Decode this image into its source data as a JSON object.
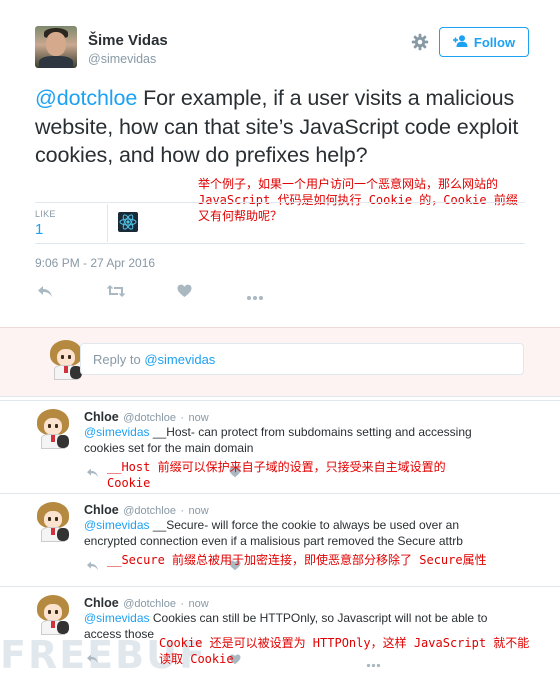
{
  "author": {
    "name": "Šime Vidas",
    "handle": "@simevidas"
  },
  "follow_label": "Follow",
  "tweet": {
    "mention": "@dotchloe",
    "text": " For example, if a user visits a malicious website, how can that site’s JavaScript code exploit cookies, and how do prefixes help?",
    "translation": "举个例子，如果一个用户访问一个恶意网站，那么网站的 JavaScript 代码是如何执行 Cookie 的，Cookie 前缀又有何帮助呢？",
    "like_label": "LIKE",
    "like_count": "1",
    "timestamp": "9:06 PM - 27 Apr 2016"
  },
  "reply_box": {
    "prefix": "Reply to ",
    "mention": "@simevidas"
  },
  "replies": [
    {
      "name": "Chloe",
      "handle": "@dotchloe",
      "dot": "·",
      "time": "now",
      "mention": "@simevidas",
      "text": " __Host- can protect from subdomains setting and accessing cookies set for the main domain",
      "translation": "__Host 前缀可以保护来自子域的设置，只接受来自主域设置的 Cookie"
    },
    {
      "name": "Chloe",
      "handle": "@dotchloe",
      "dot": "·",
      "time": "now",
      "mention": "@simevidas",
      "text": " __Secure- will force the cookie to always be used over an encrypted connection even if a malisious part removed the Secure attrb",
      "translation": "__Secure 前缀总被用于加密连接，即使恶意部分移除了 Secure属性"
    },
    {
      "name": "Chloe",
      "handle": "@dotchloe",
      "dot": "·",
      "time": "now",
      "mention": "@simevidas",
      "text": " Cookies can still be HTTPOnly, so Javascript will not be able to access those",
      "translation": "Cookie 还是可以被设置为 HTTPOnly，这样 JavaScript 就不能读取 Cookie"
    }
  ],
  "watermark": "FREEBUF",
  "icons": [
    "gear-icon",
    "add-user-icon",
    "reply-icon",
    "retweet-icon",
    "heart-icon",
    "more-icon"
  ],
  "colors": {
    "accent": "#1da1f2",
    "annotation": "#e00000",
    "muted": "#8899a6"
  }
}
